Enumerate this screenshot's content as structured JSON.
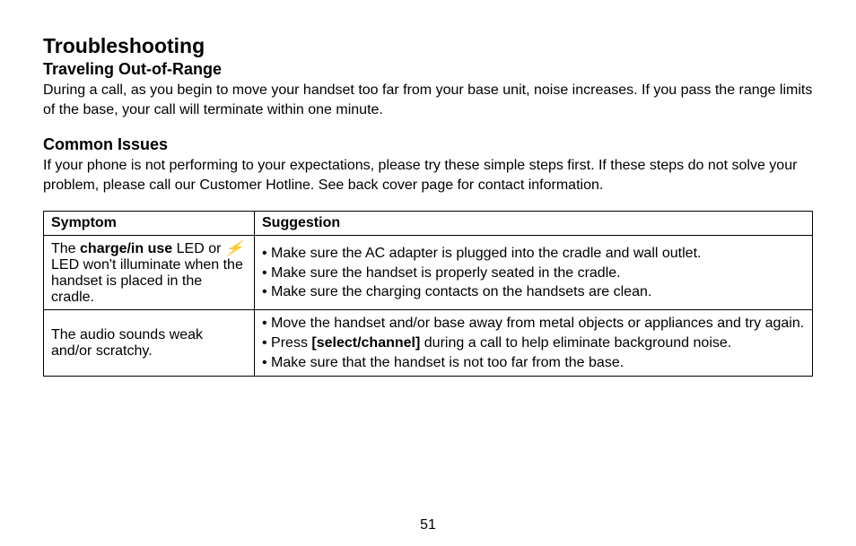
{
  "title": "Troubleshooting",
  "sections": [
    {
      "heading": "Traveling Out-of-Range",
      "body": "During a call, as you begin to move your handset too far from your base unit, noise increases. If you pass the range limits of the base, your call will terminate within one minute."
    },
    {
      "heading": "Common Issues",
      "body": "If your phone is not performing to your expectations, please try these simple steps first. If these steps do not solve your problem, please call our Customer Hotline. See back cover page for contact information."
    }
  ],
  "table": {
    "headers": [
      "Symptom",
      "Suggestion"
    ],
    "rows": [
      {
        "symptom": {
          "pre": "The ",
          "bold": "charge/in use",
          "mid": " LED or ",
          "icon": "charge-bolt-icon",
          "post": " LED won't illuminate when the handset is placed in the cradle."
        },
        "suggestions": [
          {
            "pre": "Make sure the AC adapter is plugged into the cradle and wall outlet.",
            "bold": "",
            "post": ""
          },
          {
            "pre": "Make sure the handset is properly seated in the cradle.",
            "bold": "",
            "post": ""
          },
          {
            "pre": "Make sure the charging contacts on the handsets are clean.",
            "bold": "",
            "post": ""
          }
        ]
      },
      {
        "symptom": {
          "pre": "The audio sounds weak and/or scratchy.",
          "bold": "",
          "mid": "",
          "icon": "",
          "post": ""
        },
        "suggestions": [
          {
            "pre": "Move the handset and/or base away from metal objects or appliances and try again.",
            "bold": "",
            "post": ""
          },
          {
            "pre": "Press ",
            "bold": "[select/channel]",
            "post": " during a call to help eliminate background noise."
          },
          {
            "pre": "Make sure that the handset is not too far from the base.",
            "bold": "",
            "post": ""
          }
        ]
      }
    ]
  },
  "icons": {
    "charge-bolt-icon": "⚡"
  },
  "page_number": "51"
}
